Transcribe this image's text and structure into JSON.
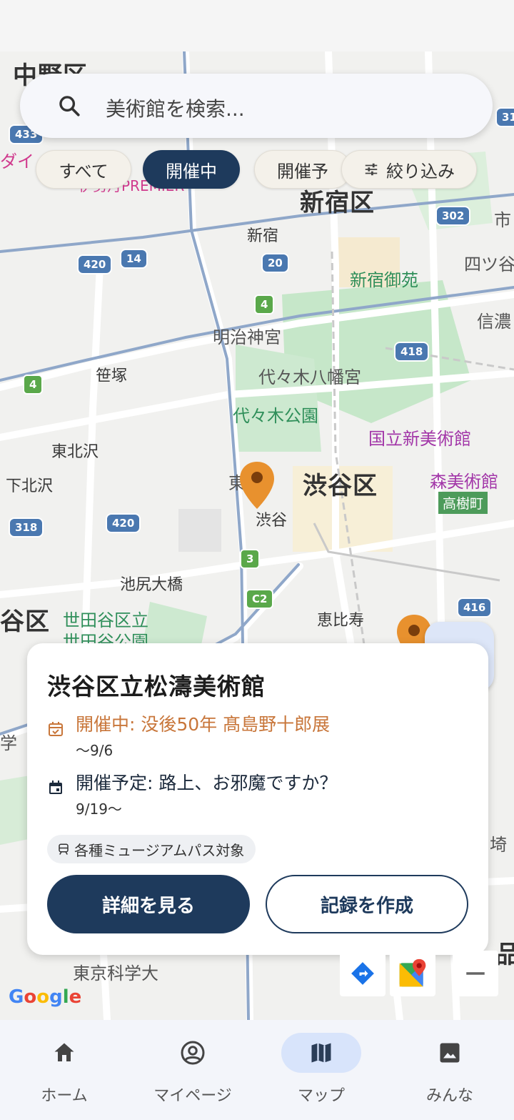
{
  "search": {
    "placeholder": "美術館を検索..."
  },
  "filters": {
    "chips": [
      {
        "label": "すべて",
        "active": false
      },
      {
        "label": "開催中",
        "active": true
      },
      {
        "label": "開催予",
        "active": false
      },
      {
        "label": "絞り込み",
        "active": false
      }
    ]
  },
  "map": {
    "labels": {
      "nakano": "中野区",
      "shinjuku_ku": "新宿区",
      "shibuya_ku": "渋谷区",
      "setagaya_partial": "谷区",
      "shinjuku": "新宿",
      "shinjuku_gyoen": "新宿御苑",
      "yotsuya": "四ツ谷",
      "shinano": "信濃",
      "meiji_jingu": "明治神宮",
      "yoyogi_hachimangu": "代々木八幡宮",
      "yoyogi_koen": "代々木公園",
      "sasazuka": "笹塚",
      "higashi_kitazawa": "東北沢",
      "shimo_kitazawa": "下北沢",
      "kokuritsu_shin": "国立新美術館",
      "mori": "森美術館",
      "takagicho": "高樹町",
      "shibuya": "渋谷",
      "todai": "東大",
      "ikejiri": "池尻大橋",
      "setagaya_koen": "世田谷区立",
      "setagaya_koen2": "世田谷公園",
      "ebisu": "恵比寿",
      "tokyo_kagaku": "東京科学大",
      "daiichi": "ダイ",
      "premier": "伊勢丹PREMIER",
      "ichi": "市",
      "gaku": "学",
      "ki": "埼",
      "shina": "品"
    },
    "routes": [
      "433",
      "420",
      "14",
      "20",
      "4",
      "302",
      "418",
      "4",
      "420",
      "318",
      "3",
      "C2",
      "416",
      "31"
    ]
  },
  "card": {
    "title": "渋谷区立松濤美術館",
    "events": [
      {
        "title": "開催中: 没後50年 髙島野十郎展",
        "date": "〜9/6",
        "status": "ongoing"
      },
      {
        "title": "開催予定: 路上、お邪魔ですか？",
        "date": "9/19〜",
        "status": "upcoming"
      }
    ],
    "badge": "各種ミュージアムパス対象",
    "primary_button": "詳細を見る",
    "secondary_button": "記録を作成"
  },
  "google": "Google",
  "nav": {
    "items": [
      {
        "label": "ホーム",
        "icon": "home-icon"
      },
      {
        "label": "マイページ",
        "icon": "account-icon"
      },
      {
        "label": "マップ",
        "icon": "map-icon",
        "active": true
      },
      {
        "label": "みんな",
        "icon": "gallery-icon"
      }
    ]
  },
  "colors": {
    "primary": "#1e3a5c",
    "accent": "#c8763a",
    "pin": "#e8912e"
  }
}
